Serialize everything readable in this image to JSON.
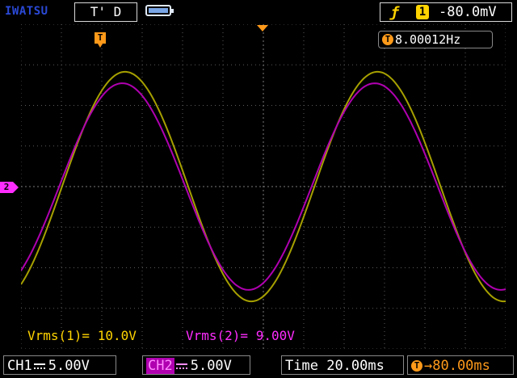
{
  "header": {
    "brand": "IWATSU",
    "acq_mode": "T' D",
    "battery_icon": "battery-icon",
    "trigger": {
      "edge_icon": "rising-edge-icon",
      "channel": "1",
      "level": "-80.0mV"
    }
  },
  "overlay": {
    "frequency": "8.00012Hz",
    "trigger_marker": "T",
    "ch2_marker": "2"
  },
  "measurements": {
    "ch1": "Vrms(1)= 10.0V",
    "ch2": "Vrms(2)= 9.00V"
  },
  "footer": {
    "ch1_label": "CH1",
    "ch1_scale": "5.00V",
    "ch2_label": "CH2",
    "ch2_scale": "5.00V",
    "time_label": "Time",
    "time_scale": "20.00ms",
    "delay_value": "→80.00ms"
  },
  "colors": {
    "ch1": "#a6a000",
    "ch2": "#b000b0",
    "grid": "#5a5a5a",
    "trigger": "#ff9a1a"
  },
  "waveforms": {
    "ch1": {
      "frequency_hz": 8.00012,
      "rms_v": 10.0,
      "scale_v_per_div": 5.0
    },
    "ch2": {
      "frequency_hz": 8.00012,
      "rms_v": 9.0,
      "scale_v_per_div": 5.0
    }
  }
}
